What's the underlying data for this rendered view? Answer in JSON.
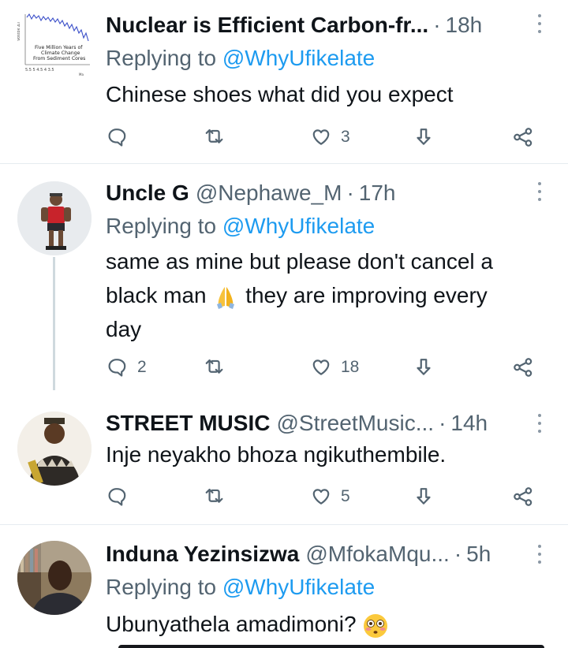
{
  "tweets": [
    {
      "name": "Nuclear is Efficient Carbon-fr...",
      "handle": "",
      "time": "18h",
      "reply_prefix": "Replying to",
      "reply_mention": "@WhyUfikelate",
      "text": "Chinese shoes what did you expect",
      "reply_count": "",
      "like_count": "3",
      "avatar_caption_line1": "Five Million Years of",
      "avatar_caption_line2": "Climate Change",
      "avatar_caption_line3": "From Sediment Cores"
    },
    {
      "name": "Uncle G",
      "handle": "@Nephawe_M",
      "time": "17h",
      "reply_prefix": "Replying to",
      "reply_mention": "@WhyUfikelate",
      "text_line1": "same as mine but please don't cancel a",
      "text_line2a": "black man",
      "text_emoji": "folded-hands",
      "text_line2b": "they are improving every",
      "text_line3": "day",
      "reply_count": "2",
      "like_count": "18"
    },
    {
      "name": "STREET MUSIC",
      "handle": "@StreetMusic...",
      "time": "14h",
      "text": "Inje neyakho bhoza ngikuthembile.",
      "reply_count": "",
      "like_count": "5"
    },
    {
      "name": "Induna Yezinsizwa",
      "handle": "@MfokaMqu...",
      "time": "5h",
      "reply_prefix": "Replying to",
      "reply_mention": "@WhyUfikelate",
      "text": "Ubunyathela amadimoni?",
      "text_emoji": "flushed-face"
    }
  ],
  "colors": {
    "accent": "#1d9bf0",
    "muted": "#536471",
    "divider": "#e6ecf0"
  },
  "icons": [
    "reply-icon",
    "retweet-icon",
    "like-icon",
    "download-icon",
    "share-icon",
    "more-icon"
  ]
}
